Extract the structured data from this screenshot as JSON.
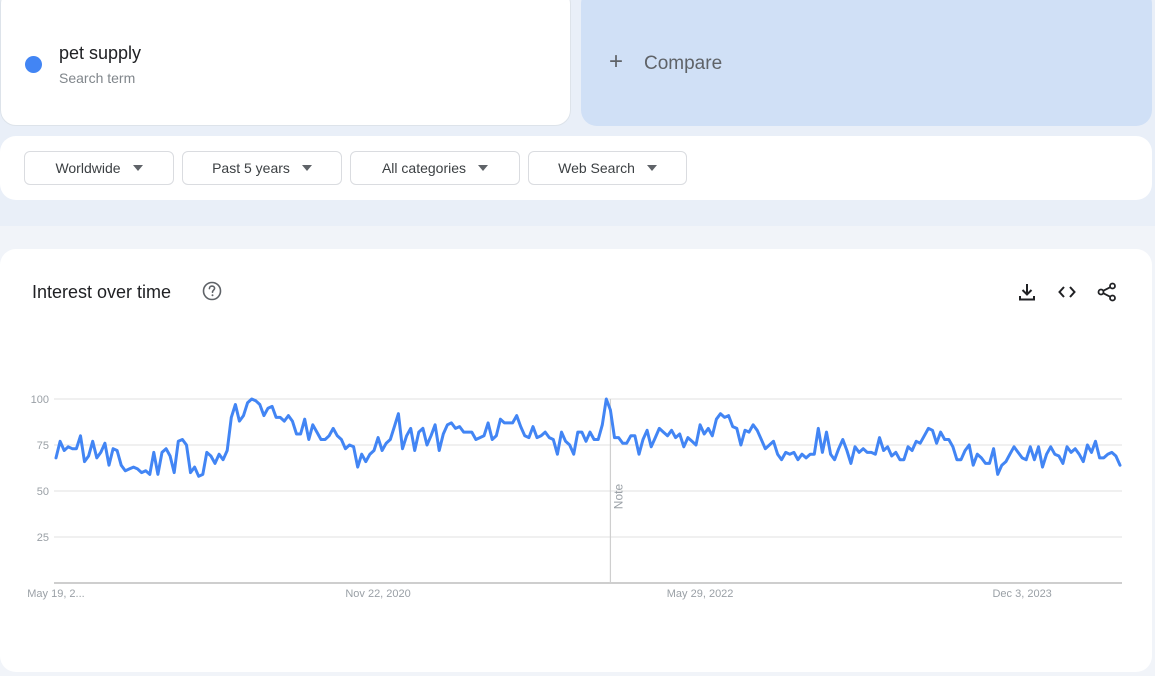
{
  "search_term": {
    "name": "pet supply",
    "type_label": "Search term",
    "color": "#4285f4"
  },
  "compare": {
    "icon": "plus-icon",
    "label": "Compare"
  },
  "filters": [
    {
      "label": "Worldwide"
    },
    {
      "label": "Past 5 years"
    },
    {
      "label": "All categories"
    },
    {
      "label": "Web Search"
    }
  ],
  "chart_panel": {
    "title": "Interest over time",
    "help_icon": "help-circle-icon",
    "actions": [
      {
        "name": "download",
        "icon": "download-icon"
      },
      {
        "name": "embed",
        "icon": "code-icon"
      },
      {
        "name": "share",
        "icon": "share-icon"
      }
    ]
  },
  "chart_data": {
    "type": "line",
    "title": "Interest over time",
    "xlabel": "",
    "ylabel": "",
    "ylim": [
      0,
      100
    ],
    "yticks": [
      25,
      50,
      75,
      100
    ],
    "grid": true,
    "x_interval": "weekly",
    "x_tick_labels": [
      {
        "index": 0,
        "label": "May 19, 2..."
      },
      {
        "index": 79,
        "label": "Nov 22, 2020"
      },
      {
        "index": 158,
        "label": "May 29, 2022"
      },
      {
        "index": 237,
        "label": "Dec 3, 2023"
      }
    ],
    "annotations": [
      {
        "index": 136,
        "label": "Note"
      }
    ],
    "series": [
      {
        "name": "pet supply",
        "color": "#4285f4",
        "values": [
          68,
          77,
          72,
          74,
          73,
          73,
          80,
          66,
          69,
          77,
          68,
          71,
          76,
          64,
          73,
          72,
          64,
          61,
          62,
          63,
          62,
          60,
          61,
          59,
          71,
          59,
          71,
          73,
          69,
          60,
          77,
          78,
          75,
          60,
          63,
          58,
          59,
          71,
          69,
          65,
          70,
          67,
          72,
          90,
          97,
          88,
          91,
          98,
          100,
          99,
          97,
          91,
          95,
          96,
          90,
          90,
          88,
          91,
          88,
          81,
          81,
          89,
          78,
          86,
          82,
          78,
          78,
          80,
          84,
          80,
          78,
          73,
          75,
          74,
          63,
          70,
          66,
          70,
          72,
          79,
          72,
          76,
          78,
          85,
          92,
          73,
          80,
          84,
          72,
          82,
          84,
          75,
          80,
          86,
          72,
          81,
          86,
          87,
          84,
          85,
          82,
          82,
          82,
          78,
          79,
          80,
          87,
          78,
          80,
          89,
          87,
          87,
          87,
          91,
          85,
          80,
          79,
          85,
          79,
          80,
          82,
          79,
          78,
          70,
          82,
          77,
          75,
          70,
          82,
          82,
          77,
          82,
          78,
          78,
          86,
          100,
          94,
          79,
          79,
          76,
          76,
          80,
          80,
          70,
          78,
          83,
          74,
          79,
          84,
          82,
          80,
          83,
          79,
          81,
          74,
          79,
          77,
          75,
          86,
          81,
          84,
          80,
          89,
          92,
          90,
          91,
          85,
          84,
          75,
          83,
          82,
          86,
          83,
          78,
          73,
          75,
          77,
          70,
          67,
          71,
          70,
          71,
          67,
          70,
          68,
          70,
          70,
          84,
          71,
          82,
          70,
          67,
          73,
          78,
          72,
          65,
          74,
          71,
          73,
          71,
          71,
          70,
          79,
          72,
          74,
          69,
          71,
          67,
          67,
          74,
          72,
          77,
          76,
          80,
          84,
          83,
          76,
          82,
          78,
          78,
          74,
          67,
          67,
          72,
          75,
          64,
          70,
          68,
          65,
          65,
          73,
          59,
          64,
          66,
          70,
          74,
          71,
          68,
          67,
          74,
          67,
          74,
          63,
          70,
          74,
          70,
          69,
          65,
          74,
          71,
          73,
          70,
          66,
          75,
          71,
          77,
          68,
          68,
          70,
          71,
          69,
          64
        ]
      }
    ]
  }
}
